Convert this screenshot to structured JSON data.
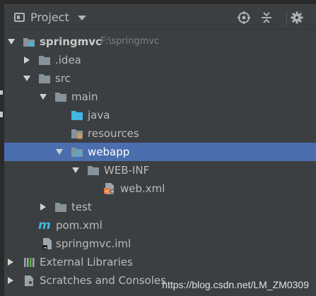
{
  "header": {
    "title": "Project",
    "view_icon": "project-view-icon",
    "actions": [
      "locate-icon",
      "collapse-all-icon",
      "gear-icon"
    ]
  },
  "tree": {
    "root": {
      "label": "springmvc",
      "path": "F:\\springmvc"
    },
    "idea": "idea-folder",
    "idea_label": ".idea",
    "src": "src",
    "main": "main",
    "java": "java",
    "resources": "resources",
    "webapp": "webapp",
    "webinf": "WEB-INF",
    "webxml": "web.xml",
    "test": "test",
    "pom": "pom.xml",
    "iml": "springmvc.iml",
    "external": "External Libraries",
    "scratches": "Scratches and Consoles"
  },
  "watermark": "https://blog.csdn.net/LM_ZM0309",
  "colors": {
    "background": "#3c3f41",
    "selection": "#4b6eaf",
    "folder": "#87939a",
    "source_folder": "#40b6e0",
    "text": "#bbbbbb"
  }
}
